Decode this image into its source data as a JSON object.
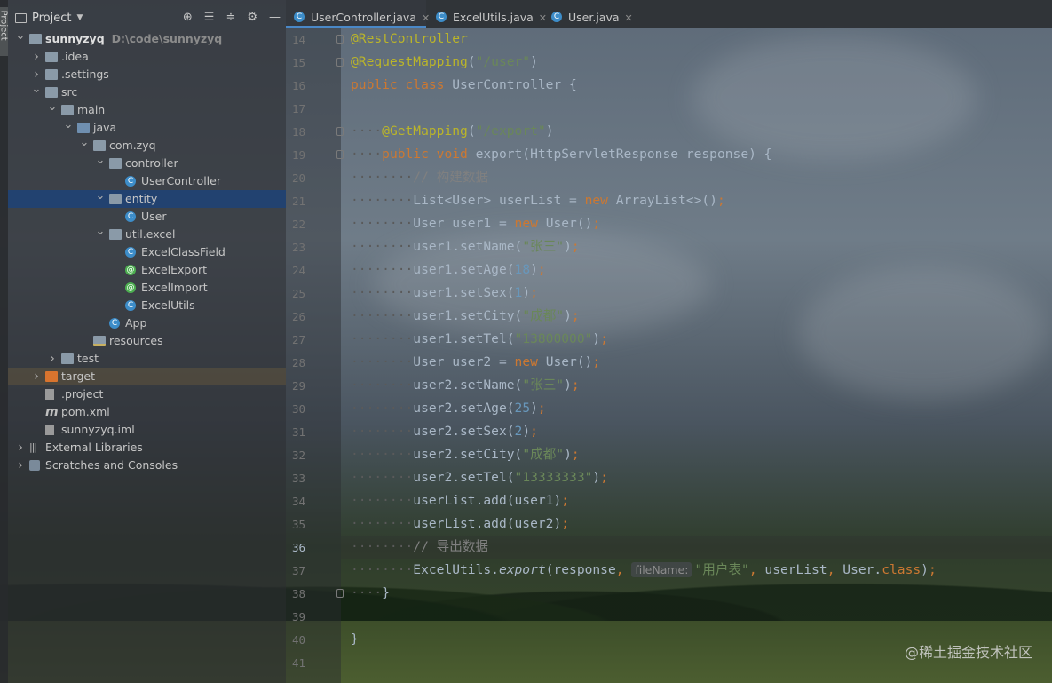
{
  "strip_label": "Project",
  "project": {
    "title": "Project",
    "tree": [
      {
        "label": "sunnyzyq",
        "path": "D:\\code\\sunnyzyq",
        "depth": 0,
        "arrow": "open",
        "icon": "module",
        "bold": true
      },
      {
        "label": ".idea",
        "depth": 1,
        "arrow": "closed",
        "icon": "folder"
      },
      {
        "label": ".settings",
        "depth": 1,
        "arrow": "closed",
        "icon": "folder"
      },
      {
        "label": "src",
        "depth": 1,
        "arrow": "open",
        "icon": "folder"
      },
      {
        "label": "main",
        "depth": 2,
        "arrow": "open",
        "icon": "folder"
      },
      {
        "label": "java",
        "depth": 3,
        "arrow": "open",
        "icon": "folder-blue"
      },
      {
        "label": "com.zyq",
        "depth": 4,
        "arrow": "open",
        "icon": "package"
      },
      {
        "label": "controller",
        "depth": 5,
        "arrow": "open",
        "icon": "package"
      },
      {
        "label": "UserController",
        "depth": 6,
        "icon": "class"
      },
      {
        "label": "entity",
        "depth": 5,
        "arrow": "open",
        "icon": "package",
        "selected": true
      },
      {
        "label": "User",
        "depth": 6,
        "icon": "class"
      },
      {
        "label": "util.excel",
        "depth": 5,
        "arrow": "open",
        "icon": "package"
      },
      {
        "label": "ExcelClassField",
        "depth": 6,
        "icon": "class"
      },
      {
        "label": "ExcelExport",
        "depth": 6,
        "icon": "annotation"
      },
      {
        "label": "ExcelImport",
        "depth": 6,
        "icon": "annotation"
      },
      {
        "label": "ExcelUtils",
        "depth": 6,
        "icon": "class"
      },
      {
        "label": "App",
        "depth": 5,
        "icon": "class"
      },
      {
        "label": "resources",
        "depth": 4,
        "icon": "resources"
      },
      {
        "label": "test",
        "depth": 2,
        "arrow": "closed",
        "icon": "folder"
      },
      {
        "label": "target",
        "depth": 1,
        "arrow": "closed",
        "icon": "folder-orange",
        "highlight": true
      },
      {
        "label": ".project",
        "depth": 1,
        "icon": "file"
      },
      {
        "label": "pom.xml",
        "depth": 1,
        "icon": "maven"
      },
      {
        "label": "sunnyzyq.iml",
        "depth": 1,
        "icon": "file"
      },
      {
        "label": "External Libraries",
        "depth": 0,
        "arrow": "closed",
        "icon": "libraries"
      },
      {
        "label": "Scratches and Consoles",
        "depth": 0,
        "arrow": "closed",
        "icon": "scratches"
      }
    ]
  },
  "tabs": [
    {
      "label": "UserController.java",
      "active": true
    },
    {
      "label": "ExcelUtils.java",
      "active": false
    },
    {
      "label": "User.java",
      "active": false
    }
  ],
  "editor": {
    "current_line": 36,
    "lines": [
      {
        "n": 14,
        "indent": 0,
        "tokens": [
          [
            "an",
            "@RestController"
          ]
        ]
      },
      {
        "n": 15,
        "indent": 0,
        "tokens": [
          [
            "an",
            "@RequestMapping"
          ],
          [
            "",
            "("
          ],
          [
            "st",
            "\"/user\""
          ],
          [
            "",
            ")"
          ]
        ]
      },
      {
        "n": 16,
        "indent": 0,
        "tokens": [
          [
            "kw",
            "public class "
          ],
          [
            "",
            "UserController {"
          ]
        ]
      },
      {
        "n": 17,
        "indent": 0,
        "tokens": []
      },
      {
        "n": 18,
        "indent": 1,
        "tokens": [
          [
            "an",
            "@GetMapping"
          ],
          [
            "",
            "("
          ],
          [
            "st",
            "\"/export\""
          ],
          [
            "",
            ")"
          ]
        ]
      },
      {
        "n": 19,
        "indent": 1,
        "tokens": [
          [
            "kw",
            "public void "
          ],
          [
            "",
            "export(HttpServletResponse response) {"
          ]
        ]
      },
      {
        "n": 20,
        "indent": 2,
        "tokens": [
          [
            "cm",
            "// 构建数据"
          ]
        ]
      },
      {
        "n": 21,
        "indent": 2,
        "tokens": [
          [
            "",
            "List<User> userList = "
          ],
          [
            "kw",
            "new "
          ],
          [
            "",
            "ArrayList<>()"
          ],
          [
            "kw",
            ";"
          ]
        ]
      },
      {
        "n": 22,
        "indent": 2,
        "tokens": [
          [
            "",
            "User user1 = "
          ],
          [
            "kw",
            "new "
          ],
          [
            "",
            "User()"
          ],
          [
            "kw",
            ";"
          ]
        ]
      },
      {
        "n": 23,
        "indent": 2,
        "tokens": [
          [
            "",
            "user1.setName("
          ],
          [
            "st",
            "\"张三\""
          ],
          [
            "",
            ")"
          ],
          [
            "kw",
            ";"
          ]
        ]
      },
      {
        "n": 24,
        "indent": 2,
        "tokens": [
          [
            "",
            "user1.setAge("
          ],
          [
            "nm",
            "18"
          ],
          [
            "",
            ")"
          ],
          [
            "kw",
            ";"
          ]
        ]
      },
      {
        "n": 25,
        "indent": 2,
        "tokens": [
          [
            "",
            "user1.setSex("
          ],
          [
            "nm",
            "1"
          ],
          [
            "",
            ")"
          ],
          [
            "kw",
            ";"
          ]
        ]
      },
      {
        "n": 26,
        "indent": 2,
        "tokens": [
          [
            "",
            "user1.setCity("
          ],
          [
            "st",
            "\"成都\""
          ],
          [
            "",
            ")"
          ],
          [
            "kw",
            ";"
          ]
        ]
      },
      {
        "n": 27,
        "indent": 2,
        "tokens": [
          [
            "",
            "user1.setTel("
          ],
          [
            "st",
            "\"13800000\""
          ],
          [
            "",
            ")"
          ],
          [
            "kw",
            ";"
          ]
        ]
      },
      {
        "n": 28,
        "indent": 2,
        "tokens": [
          [
            "",
            "User user2 = "
          ],
          [
            "kw",
            "new "
          ],
          [
            "",
            "User()"
          ],
          [
            "kw",
            ";"
          ]
        ]
      },
      {
        "n": 29,
        "indent": 2,
        "tokens": [
          [
            "",
            "user2.setName("
          ],
          [
            "st",
            "\"张三\""
          ],
          [
            "",
            ")"
          ],
          [
            "kw",
            ";"
          ]
        ]
      },
      {
        "n": 30,
        "indent": 2,
        "tokens": [
          [
            "",
            "user2.setAge("
          ],
          [
            "nm",
            "25"
          ],
          [
            "",
            ")"
          ],
          [
            "kw",
            ";"
          ]
        ]
      },
      {
        "n": 31,
        "indent": 2,
        "tokens": [
          [
            "",
            "user2.setSex("
          ],
          [
            "nm",
            "2"
          ],
          [
            "",
            ")"
          ],
          [
            "kw",
            ";"
          ]
        ]
      },
      {
        "n": 32,
        "indent": 2,
        "tokens": [
          [
            "",
            "user2.setCity("
          ],
          [
            "st",
            "\"成都\""
          ],
          [
            "",
            ")"
          ],
          [
            "kw",
            ";"
          ]
        ]
      },
      {
        "n": 33,
        "indent": 2,
        "tokens": [
          [
            "",
            "user2.setTel("
          ],
          [
            "st",
            "\"13333333\""
          ],
          [
            "",
            ")"
          ],
          [
            "kw",
            ";"
          ]
        ]
      },
      {
        "n": 34,
        "indent": 2,
        "tokens": [
          [
            "",
            "userList.add(user1)"
          ],
          [
            "kw",
            ";"
          ]
        ]
      },
      {
        "n": 35,
        "indent": 2,
        "tokens": [
          [
            "",
            "userList.add(user2)"
          ],
          [
            "kw",
            ";"
          ]
        ]
      },
      {
        "n": 36,
        "indent": 2,
        "tokens": [
          [
            "cm",
            "// 导出数据"
          ]
        ]
      },
      {
        "n": 37,
        "indent": 2,
        "tokens": [
          [
            "",
            "ExcelUtils."
          ],
          [
            "it",
            "export"
          ],
          [
            "",
            "(response"
          ],
          [
            "kw",
            ", "
          ],
          [
            "hint",
            "fileName:"
          ],
          [
            "st",
            "\"用户表\""
          ],
          [
            "kw",
            ", "
          ],
          [
            "",
            "userList"
          ],
          [
            "kw",
            ", "
          ],
          [
            "",
            "User."
          ],
          [
            "kw",
            "class"
          ],
          [
            "",
            ")"
          ],
          [
            "kw",
            ";"
          ]
        ]
      },
      {
        "n": 38,
        "indent": 1,
        "tokens": [
          [
            "",
            "}"
          ]
        ]
      },
      {
        "n": 39,
        "indent": 0,
        "tokens": []
      },
      {
        "n": 40,
        "indent": 0,
        "tokens": [
          [
            "",
            "}"
          ]
        ]
      },
      {
        "n": 41,
        "indent": 0,
        "tokens": []
      }
    ]
  },
  "watermark": "@稀土掘金技术社区"
}
